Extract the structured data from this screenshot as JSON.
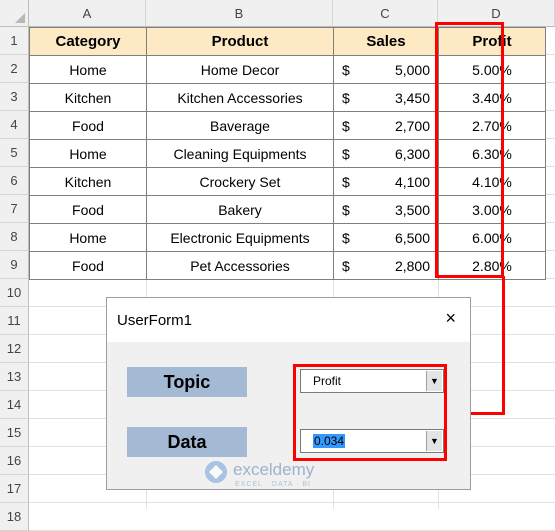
{
  "columns": [
    "A",
    "B",
    "C",
    "D"
  ],
  "rows": [
    "1",
    "2",
    "3",
    "4",
    "5",
    "6",
    "7",
    "8",
    "9",
    "10",
    "11",
    "12",
    "13",
    "14",
    "15",
    "16",
    "17",
    "18"
  ],
  "table": {
    "headers": [
      "Category",
      "Product",
      "Sales",
      "Profit"
    ],
    "currency_symbol": "$",
    "data": [
      {
        "category": "Home",
        "product": "Home Decor",
        "sales": "5,000",
        "profit": "5.00%"
      },
      {
        "category": "Kitchen",
        "product": "Kitchen Accessories",
        "sales": "3,450",
        "profit": "3.40%"
      },
      {
        "category": "Food",
        "product": "Baverage",
        "sales": "2,700",
        "profit": "2.70%"
      },
      {
        "category": "Home",
        "product": "Cleaning Equipments",
        "sales": "6,300",
        "profit": "6.30%"
      },
      {
        "category": "Kitchen",
        "product": "Crockery Set",
        "sales": "4,100",
        "profit": "4.10%"
      },
      {
        "category": "Food",
        "product": "Bakery",
        "sales": "3,500",
        "profit": "3.00%"
      },
      {
        "category": "Home",
        "product": "Electronic Equipments",
        "sales": "6,500",
        "profit": "6.00%"
      },
      {
        "category": "Food",
        "product": "Pet Accessories",
        "sales": "2,800",
        "profit": "2.80%"
      }
    ]
  },
  "userform": {
    "title": "UserForm1",
    "close_icon": "×",
    "topic_label": "Topic",
    "topic_value": "Profit",
    "data_label": "Data",
    "data_value": "0.034",
    "dropdown_glyph": "▼"
  },
  "watermark": {
    "name": "exceldemy",
    "tagline": "EXCEL · DATA · BI"
  },
  "colors": {
    "header_fill": "#fde9c4",
    "highlight": "#ff0000",
    "label_fill": "#a4b9d3",
    "selection": "#3399ff"
  }
}
